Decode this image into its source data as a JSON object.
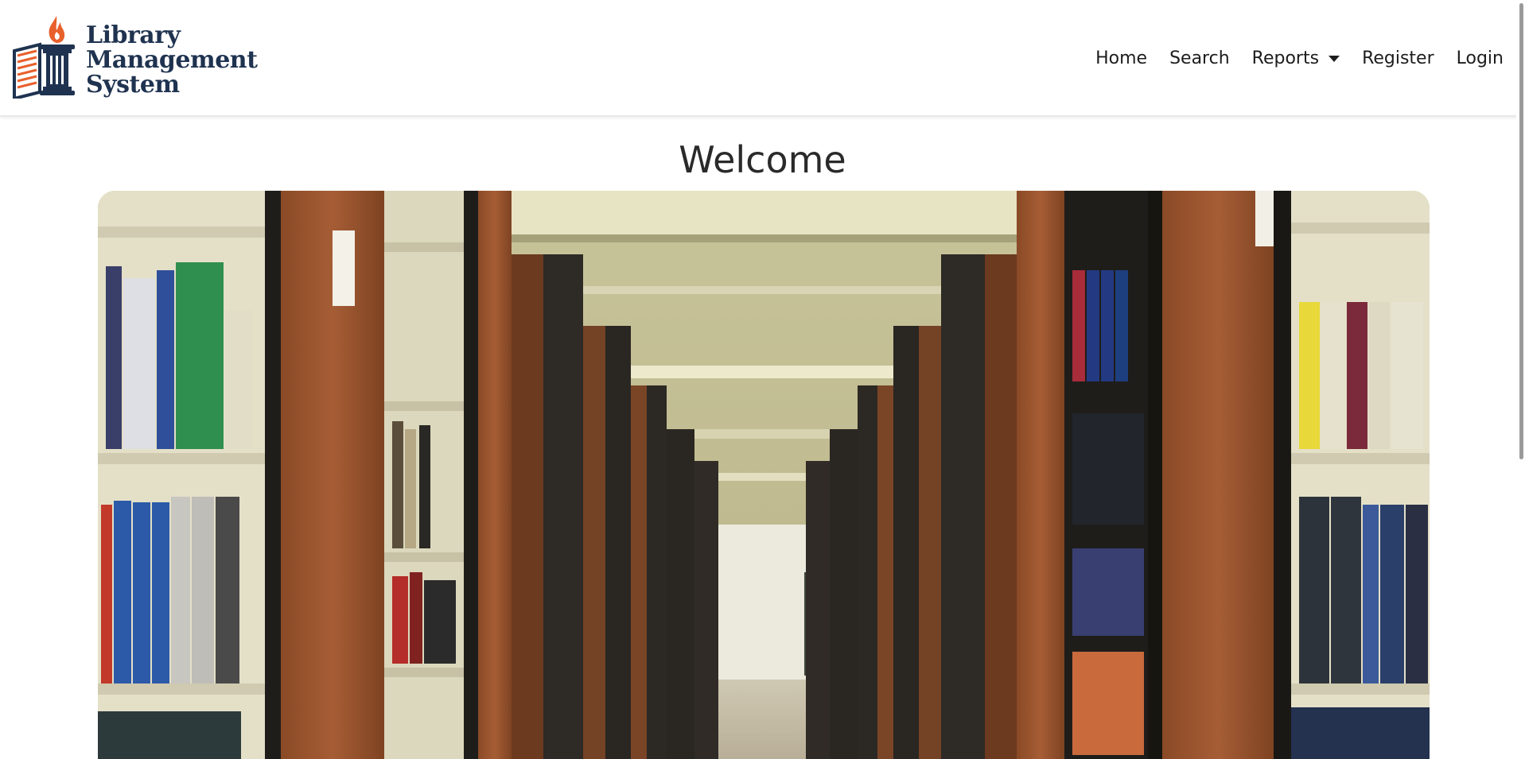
{
  "brand": {
    "line1": "Library",
    "line2": "Management",
    "line3": "System",
    "logo_icon": "pillar-book-flame-logo",
    "colors": {
      "navy": "#1f3350",
      "orange": "#e8602c"
    }
  },
  "nav": {
    "home": "Home",
    "search": "Search",
    "reports": "Reports",
    "register": "Register",
    "login": "Login"
  },
  "main": {
    "title": "Welcome",
    "hero_image": "library-bookshelves-aisle-photo"
  }
}
